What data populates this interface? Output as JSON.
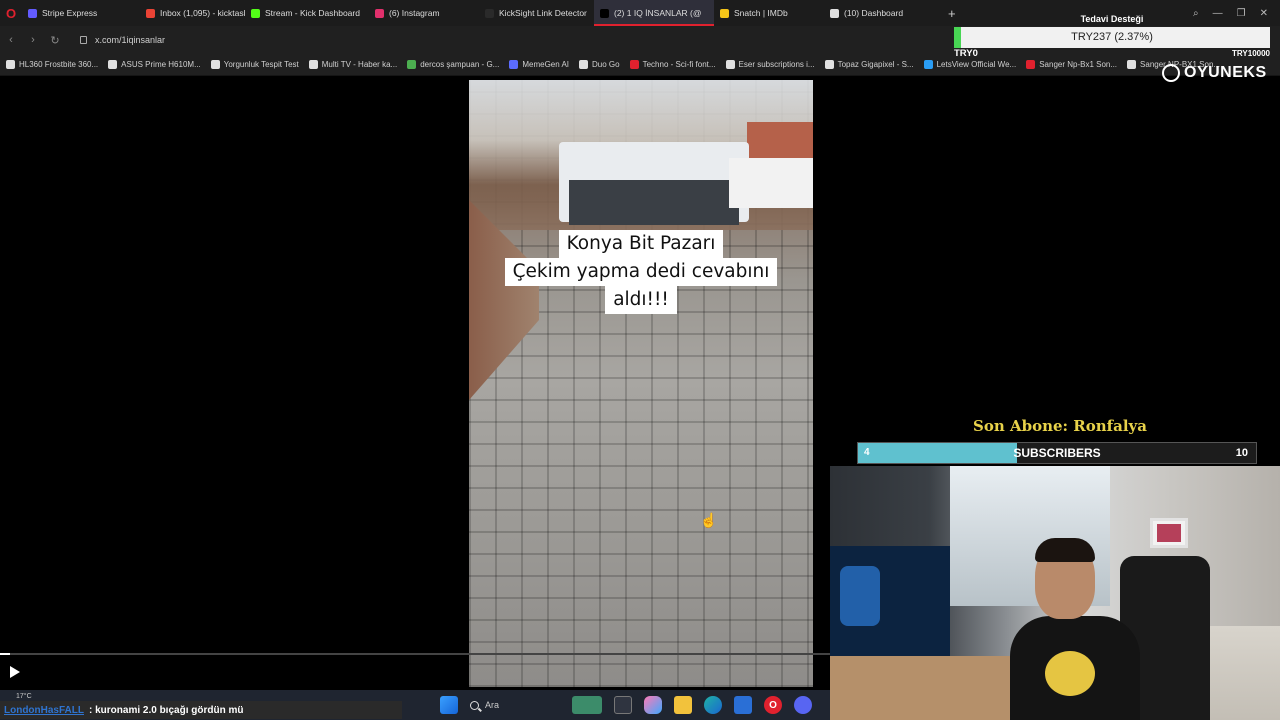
{
  "browser": {
    "tabs": [
      {
        "label": "Stripe Express",
        "color": "#635bff"
      },
      {
        "label": "Inbox (1,095) - kicktasking",
        "color": "#ea4335"
      },
      {
        "label": "Stream - Kick Dashboard",
        "color": "#53fc18"
      },
      {
        "label": "(6) Instagram",
        "color": "#e1306c"
      },
      {
        "label": "KickSight Link Detector",
        "color": "#2a2a2a"
      },
      {
        "label": "(2) 1 IQ İNSANLAR (@",
        "color": "#000000",
        "active": true
      },
      {
        "label": "Snatch | IMDb",
        "color": "#f5c518"
      },
      {
        "label": "(10) Dashboard",
        "color": "#e0e0e0"
      }
    ],
    "url": "x.com/1iqinsanlar",
    "bookmarks": [
      {
        "label": "HL360 Frostbite 360...",
        "color": "#e0e0e0"
      },
      {
        "label": "ASUS Prime H610M...",
        "color": "#e0e0e0"
      },
      {
        "label": "Yorgunluk Tespit Test",
        "color": "#e0e0e0"
      },
      {
        "label": "Multi TV - Haber ka...",
        "color": "#e0e0e0"
      },
      {
        "label": "dercos şampuan - G...",
        "color": "#4caf50"
      },
      {
        "label": "MemeGen AI",
        "color": "#5b6cff"
      },
      {
        "label": "Duo Go",
        "color": "#e0e0e0"
      },
      {
        "label": "Techno - Sci-fi font...",
        "color": "#e0212e"
      },
      {
        "label": "Eser subscriptions i...",
        "color": "#e0e0e0"
      },
      {
        "label": "Topaz Gigapixel - S...",
        "color": "#e0e0e0"
      },
      {
        "label": "LetsView Official We...",
        "color": "#2a9df4"
      },
      {
        "label": "Sanger Np-Bx1 Son...",
        "color": "#e0212e"
      },
      {
        "label": "Sanger NP-BX1 Son...",
        "color": "#e0e0e0"
      }
    ]
  },
  "video": {
    "caption_lines": [
      "Konya Bit Pazarı",
      "Çekim yapma dedi cevabını",
      "aldı!!!"
    ],
    "progress": 0.012
  },
  "donation": {
    "title": "Tedavi Desteği",
    "amount_text": "TRY237 (2.37%)",
    "min": "TRY0",
    "max": "TRY10000",
    "progress": 0.0237
  },
  "brand": {
    "name": "OYUNEKS"
  },
  "subscribers": {
    "title": "Son Abone: Ronfalya",
    "current": "4",
    "label": "SUBSCRIBERS",
    "goal": "10",
    "progress": 0.4
  },
  "taskbar": {
    "weather": "17°C",
    "search_label": "Ara",
    "chat_user": "LondonHasFALL",
    "chat_message": ": kuronami 2.0 bıçağı gördün mü"
  },
  "colors": {
    "accent": "#e0212e",
    "donation_fill": "#48d654",
    "sub_fill": "#5fc1cf",
    "sub_title": "#e8d24a"
  }
}
